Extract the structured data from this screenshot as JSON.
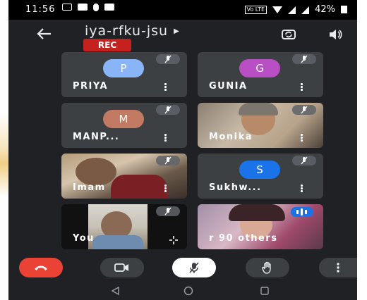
{
  "status_bar": {
    "time": "11:56",
    "battery": "42%",
    "volte": "Vo LTE"
  },
  "header": {
    "meeting_code": "iya-rfku-jsu",
    "rec_label": "REC",
    "icons": [
      "back-arrow-icon",
      "flip-camera-icon",
      "speaker-icon"
    ]
  },
  "tiles": [
    {
      "name": "PRIYA",
      "initial": "P",
      "avatar_color": "#8ab4f8",
      "type": "avatar",
      "muted": true
    },
    {
      "name": "GUNIA",
      "initial": "G",
      "avatar_color": "#b84fc4",
      "type": "avatar",
      "muted": true
    },
    {
      "name": "MANP...",
      "initial": "M",
      "avatar_color": "#c27a62",
      "type": "avatar",
      "muted": true
    },
    {
      "name": "Monika",
      "type": "video",
      "muted": true
    },
    {
      "name": "Imam",
      "type": "video",
      "muted": true
    },
    {
      "name": "Sukhw...",
      "initial": "S",
      "avatar_color": "#1a73e8",
      "type": "avatar",
      "muted": true
    },
    {
      "name": "You",
      "type": "self-video",
      "muted": true
    },
    {
      "name": "90 others",
      "name_prefix": "r",
      "type": "others",
      "muted": false
    }
  ],
  "controls": [
    "end-call",
    "camera",
    "microphone",
    "raise-hand",
    "more-options"
  ],
  "colors": {
    "end_call": "#ea4335",
    "rec": "#c5221f",
    "background": "#202124",
    "tile": "#3c4043"
  }
}
